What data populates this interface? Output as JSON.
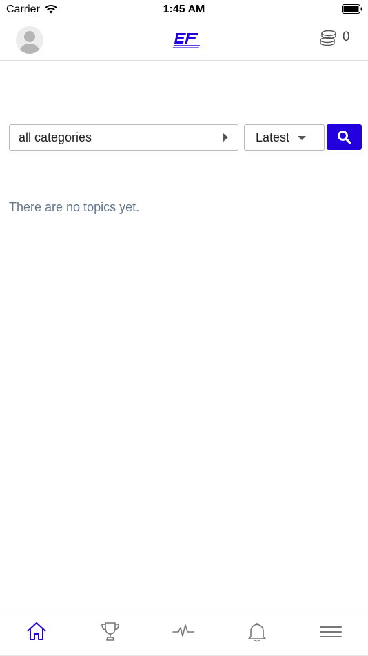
{
  "status_bar": {
    "carrier": "Carrier",
    "time": "1:45 AM"
  },
  "header": {
    "avatar_icon": "default-user-avatar",
    "logo_icon": "ef-logo",
    "coins_icon": "coins-icon",
    "coin_count": "0"
  },
  "filters": {
    "category_value": "all categories",
    "sort_value": "Latest",
    "search_icon": "search-icon"
  },
  "main": {
    "empty_message": "There are no topics yet."
  },
  "tabbar": {
    "tabs": [
      {
        "icon": "home-icon",
        "active": true
      },
      {
        "icon": "trophy-icon",
        "active": false
      },
      {
        "icon": "activity-icon",
        "active": false
      },
      {
        "icon": "bell-icon",
        "active": false
      },
      {
        "icon": "menu-icon",
        "active": false
      }
    ]
  },
  "colors": {
    "accent": "#2200dd",
    "muted_text": "#62788e",
    "tab_inactive": "#777777"
  }
}
